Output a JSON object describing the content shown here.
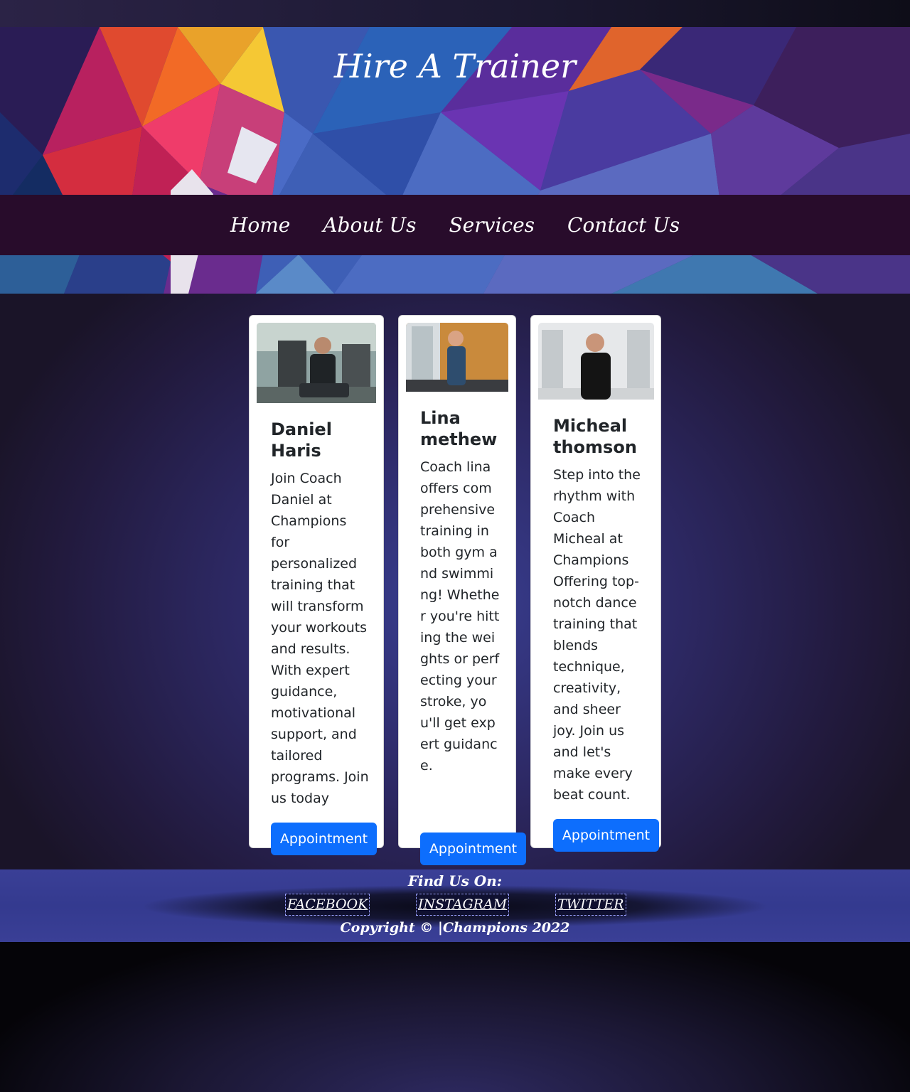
{
  "header": {
    "title": "Hire A Trainer"
  },
  "nav": {
    "items": [
      {
        "label": "Home"
      },
      {
        "label": "About Us"
      },
      {
        "label": "Services"
      },
      {
        "label": "Contact Us"
      }
    ]
  },
  "trainers": [
    {
      "name": "Daniel Haris",
      "description": "Join Coach Daniel at Champions for personalized training that will transform your workouts and results. With expert guidance, motivational support, and tailored programs. Join us today",
      "button_label": "Appointment"
    },
    {
      "name": "Lina methew",
      "description": "Coach lina offers comprehensive training in both gym and swimming! Whether you're hitting the weights or perfecting your stroke, you'll get expert guidance.",
      "button_label": "Appointment"
    },
    {
      "name": "Micheal thomson",
      "description": "Step into the rhythm with Coach Micheal at Champions Offering top-notch dance training that blends technique, creativity, and sheer joy. Join us and let's make every beat count.",
      "button_label": "Appointment"
    }
  ],
  "footer": {
    "find_us_label": "Find Us On:",
    "social_links": [
      {
        "label": "FACEBOOK"
      },
      {
        "label": "INSTAGRAM"
      },
      {
        "label": "TWITTER"
      }
    ],
    "copyright": "Copyright © |Champions 2022"
  },
  "colors": {
    "nav_background": "#280c2b",
    "button_primary": "#0d6efd",
    "footer_background": "#3a3f96"
  }
}
